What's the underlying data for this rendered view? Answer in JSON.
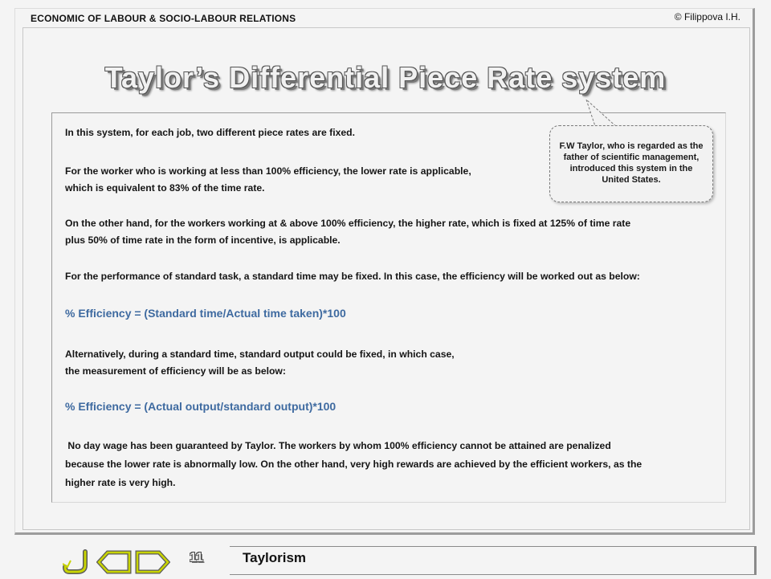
{
  "header": {
    "course": "ECONOMIC OF LABOUR & SOCIO-LABOUR RELATIONS",
    "copyright": "© Filippova I.H."
  },
  "slide": {
    "title": "Taylor’s Differential Piece Rate system",
    "callout": "F.W Taylor, who is regarded as the father of scientific management, introduced this system in the United States.",
    "paragraphs": {
      "p1": "In this system, for each job, two different piece rates are fixed.",
      "p2a": "For the worker who is working at less than 100% efficiency, the lower rate is applicable,",
      "p2b": "which is equivalent to 83% of the time rate.",
      "p3a": "On the other hand, for the workers working at & above 100% efficiency, the higher rate, which is fixed at 125% of time rate",
      "p3b": "plus 50% of time rate in the form of incentive, is applicable.",
      "p4": "For the performance of standard task, a standard time may be fixed. In this case, the efficiency will be worked out as below:",
      "p5a": "Alternatively, during a standard time, standard output could be fixed, in which case,",
      "p5b": "the measurement of efficiency will be as below:",
      "p6a": " No day wage has been guaranteed by Taylor. The workers by whom 100% efficiency cannot be attained are penalized",
      "p6b": "because the lower rate is abnormally low. On the other hand, very high rewards are achieved by the efficient workers, as the",
      "p6c": "higher rate is very high."
    },
    "formulas": {
      "f1": "% Efficiency = (Standard time/Actual time taken)*100",
      "f2": "% Efficiency = (Actual output/standard output)*100"
    }
  },
  "footer": {
    "page_number": "11",
    "section_title": "Taylorism",
    "nav_icons": [
      "return-icon",
      "back-arrow-icon",
      "forward-arrow-icon"
    ]
  },
  "colors": {
    "formula": "#3e6aa0",
    "background": "#f4f4f4",
    "nav_icon": "#c8d400"
  }
}
